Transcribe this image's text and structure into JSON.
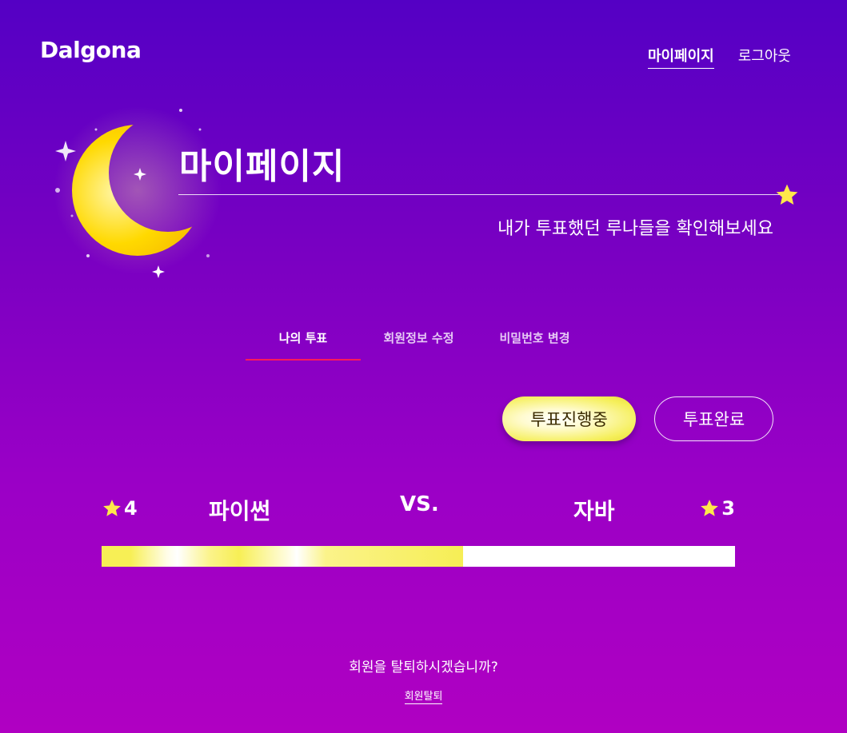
{
  "header": {
    "logo": "Dalgona",
    "nav": {
      "mypage": "마이페이지",
      "logout": "로그아웃"
    }
  },
  "hero": {
    "title": "마이페이지",
    "subtitle": "내가 투표했던 루나들을 확인해보세요",
    "icons": [
      "crescent-moon-icon",
      "star-icon"
    ]
  },
  "tabs": {
    "my_votes": "나의 투표",
    "edit_profile": "회원정보 수정",
    "change_password": "비밀번호 변경",
    "active_tab": "나의 투표"
  },
  "filters": {
    "in_progress": "투표진행중",
    "completed": "투표완료",
    "selected": "투표진행중"
  },
  "vote": {
    "left_option": "파이썬",
    "left_count": "4",
    "vs_label": "VS.",
    "right_option": "자바",
    "right_count": "3",
    "left_share": 0.571
  },
  "footer": {
    "withdraw_question": "회원을 탈퇴하시겠습니까?",
    "withdraw_link": "회원탈퇴"
  },
  "colors": {
    "background_top": "#5400c4",
    "background_bottom": "#b000c2",
    "accent_yellow": "#f7ef55",
    "tab_underline": "#ff1a5c"
  }
}
